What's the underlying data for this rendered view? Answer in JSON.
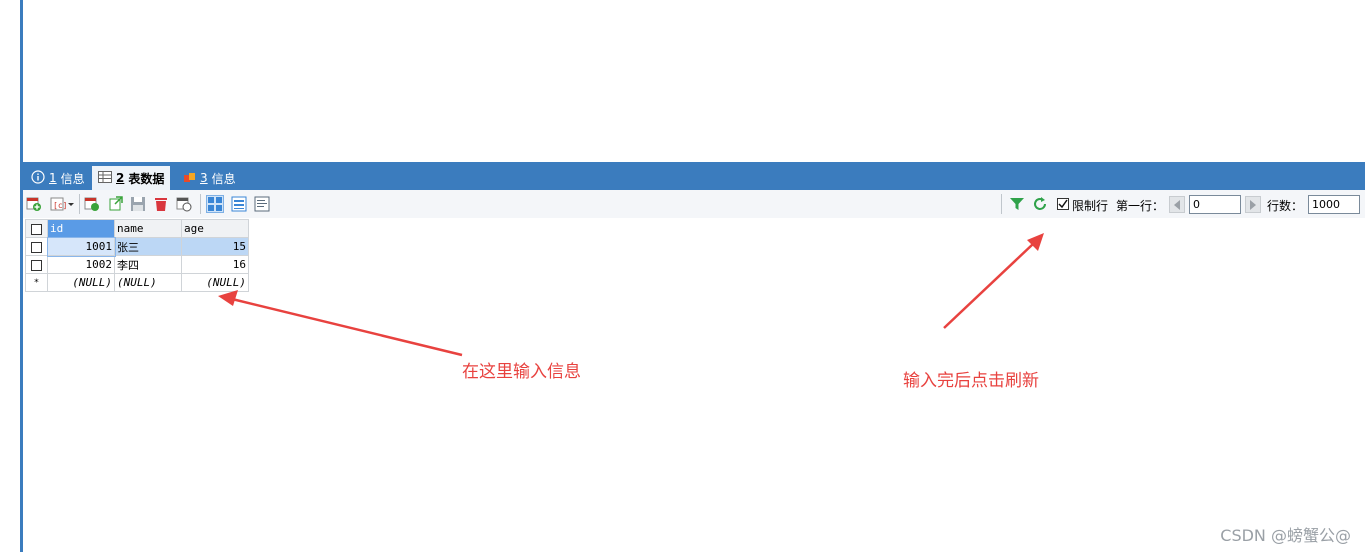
{
  "tabs": [
    {
      "num": "1",
      "label": "信息",
      "icon": "info-icon"
    },
    {
      "num": "2",
      "label": "表数据",
      "icon": "table-icon"
    },
    {
      "num": "3",
      "label": "信息",
      "icon": "cube-icon"
    }
  ],
  "toolbar": {
    "limit_rows_label": "限制行",
    "limit_rows_checked": true,
    "first_row_label": "第一行：",
    "first_row_value": "0",
    "row_count_label": "行数：",
    "row_count_value": "1000"
  },
  "grid": {
    "columns": [
      "id",
      "name",
      "age"
    ],
    "rows": [
      {
        "id": "1001",
        "name": "张三",
        "age": "15"
      },
      {
        "id": "1002",
        "name": "李四",
        "age": "16"
      },
      {
        "marker": "*",
        "id": "(NULL)",
        "name": "(NULL)",
        "age": "(NULL)"
      }
    ]
  },
  "annotations": {
    "input_info": "在这里输入信息",
    "refresh_info": "输入完后点击刷新"
  },
  "watermark": "CSDN @螃蟹公@",
  "colors": {
    "accent": "#3b7cbe",
    "annotation": "#e8423f"
  }
}
